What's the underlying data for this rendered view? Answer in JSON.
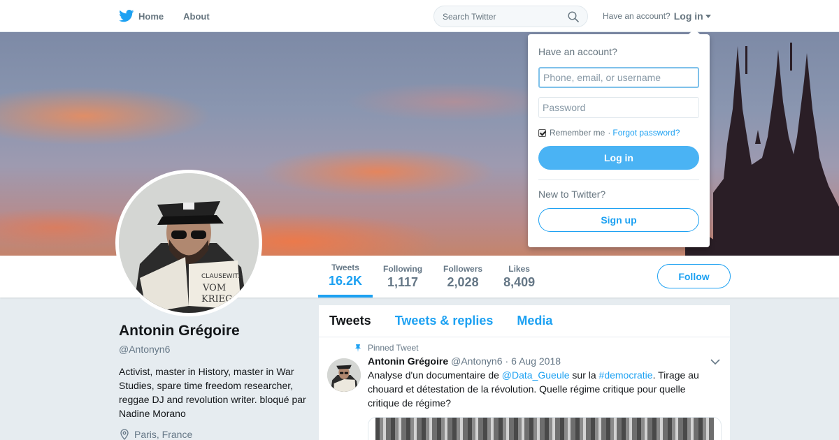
{
  "nav": {
    "home_label": "Home",
    "about_label": "About",
    "search_placeholder": "Search Twitter",
    "have_account": "Have an account?",
    "login_label": "Log in"
  },
  "profile": {
    "name": "Antonin Grégoire",
    "handle": "@Antonyn6",
    "bio": "Activist, master in History, master in War Studies, spare time freedom researcher, reggae DJ and revolution writer. bloqué par Nadine Morano",
    "location": "Paris, France",
    "follow_label": "Follow"
  },
  "stats": [
    {
      "label": "Tweets",
      "value": "16.2K"
    },
    {
      "label": "Following",
      "value": "1,117"
    },
    {
      "label": "Followers",
      "value": "2,028"
    },
    {
      "label": "Likes",
      "value": "8,409"
    }
  ],
  "timeline": {
    "tabs": [
      "Tweets",
      "Tweets & replies",
      "Media"
    ]
  },
  "tweet": {
    "pinned_label": "Pinned Tweet",
    "author": "Antonin Grégoire",
    "handle": "@Antonyn6",
    "separator": "·",
    "date": "6 Aug 2018",
    "text_1": "Analyse d'un documentaire de ",
    "mention": "@Data_Gueule",
    "text_2": " sur la ",
    "hashtag": "#democratie",
    "text_3": ". Tirage au chouard et détestation de la révolution. Quelle régime critique pour quelle critique de régime?"
  },
  "login_dropdown": {
    "title": "Have an account?",
    "username_placeholder": "Phone, email, or username",
    "password_placeholder": "Password",
    "remember_label": "Remember me",
    "separator": "·",
    "forgot_label": "Forgot password?",
    "login_button": "Log in",
    "new_label": "New to Twitter?",
    "signup_button": "Sign up"
  },
  "colors": {
    "accent": "#1da1f2",
    "login_button": "#4ab3f4",
    "background": "#e6ecf0"
  },
  "icons": [
    "twitter-bird-icon",
    "search-icon",
    "caret-down-icon",
    "location-pin-icon",
    "pin-icon",
    "chevron-down-icon"
  ]
}
